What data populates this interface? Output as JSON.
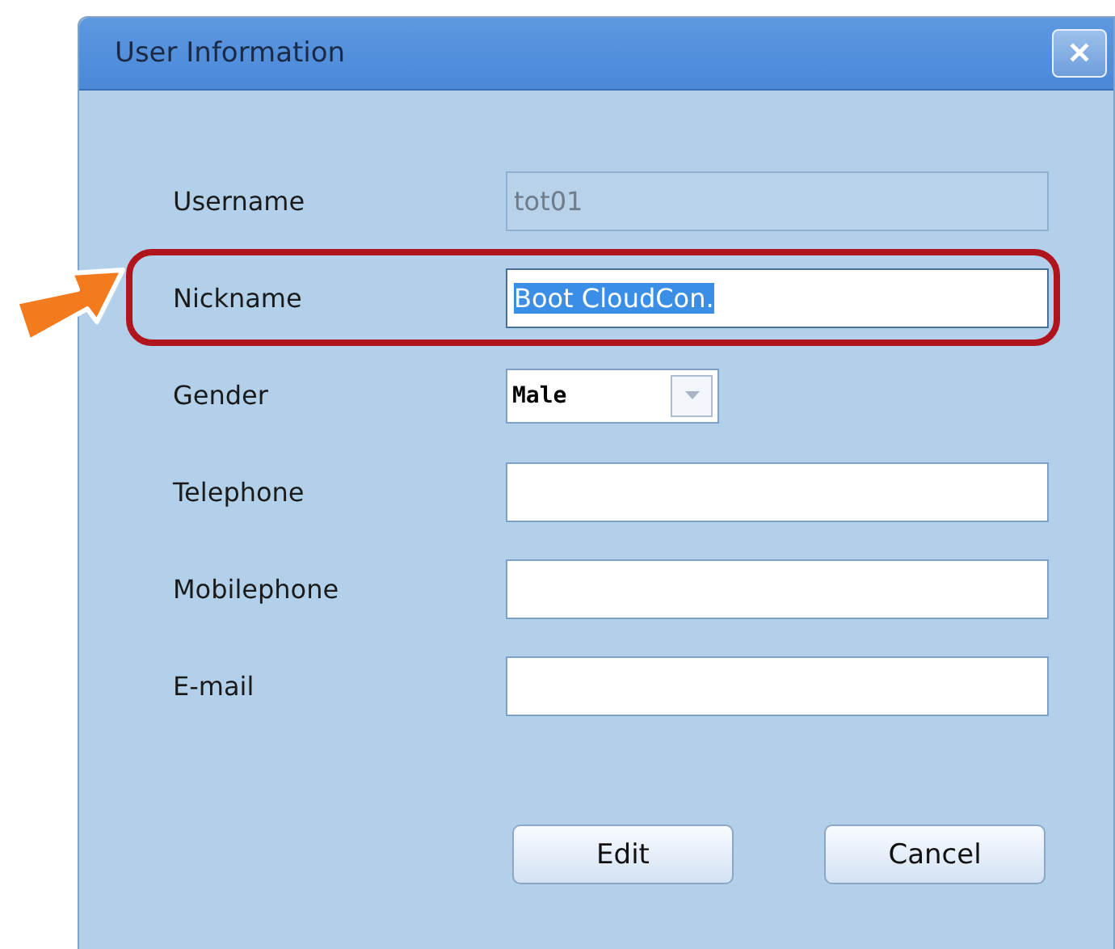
{
  "window": {
    "title": "User Information",
    "close": "✕"
  },
  "fields": [
    {
      "label": "Username",
      "kind": "text",
      "value": "tot01",
      "disabled": true,
      "text_selected": false,
      "highlighted": false
    },
    {
      "label": "Nickname",
      "kind": "text",
      "value": "Boot CloudCon.",
      "disabled": false,
      "text_selected": true,
      "highlighted": true
    },
    {
      "label": "Gender",
      "kind": "combo",
      "value": "Male",
      "disabled": false,
      "text_selected": false,
      "highlighted": false
    },
    {
      "label": "Telephone",
      "kind": "text",
      "disabled": false,
      "text_selected": false,
      "highlighted": false
    },
    {
      "label": "Mobilephone",
      "kind": "text",
      "disabled": false,
      "text_selected": false,
      "highlighted": false
    },
    {
      "label": "E-mail",
      "kind": "text",
      "disabled": false,
      "text_selected": false,
      "highlighted": false
    }
  ],
  "buttons": [
    "Edit",
    "Cancel"
  ]
}
